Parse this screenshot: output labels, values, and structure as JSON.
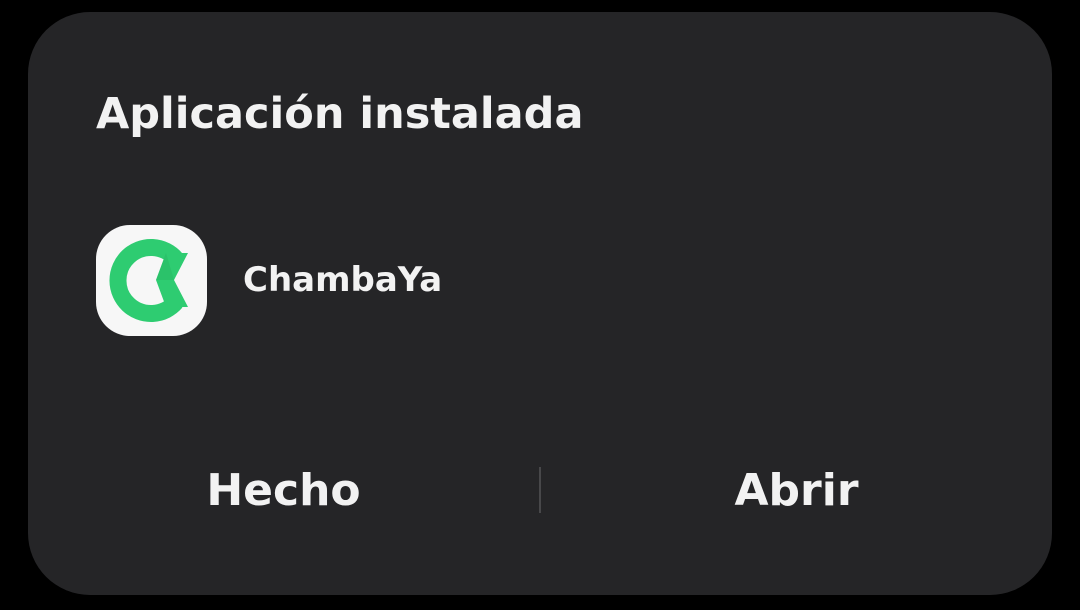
{
  "dialog": {
    "title": "Aplicación instalada",
    "app": {
      "name": "ChambaYa",
      "icon": "chambaya-app-icon",
      "icon_color": "#2ecc71",
      "icon_background": "#f7f7f7"
    },
    "buttons": {
      "done_label": "Hecho",
      "open_label": "Abrir"
    }
  },
  "colors": {
    "background": "#000000",
    "dialog_background": "#252527",
    "text": "#f2f2f2",
    "divider": "#48484a"
  }
}
